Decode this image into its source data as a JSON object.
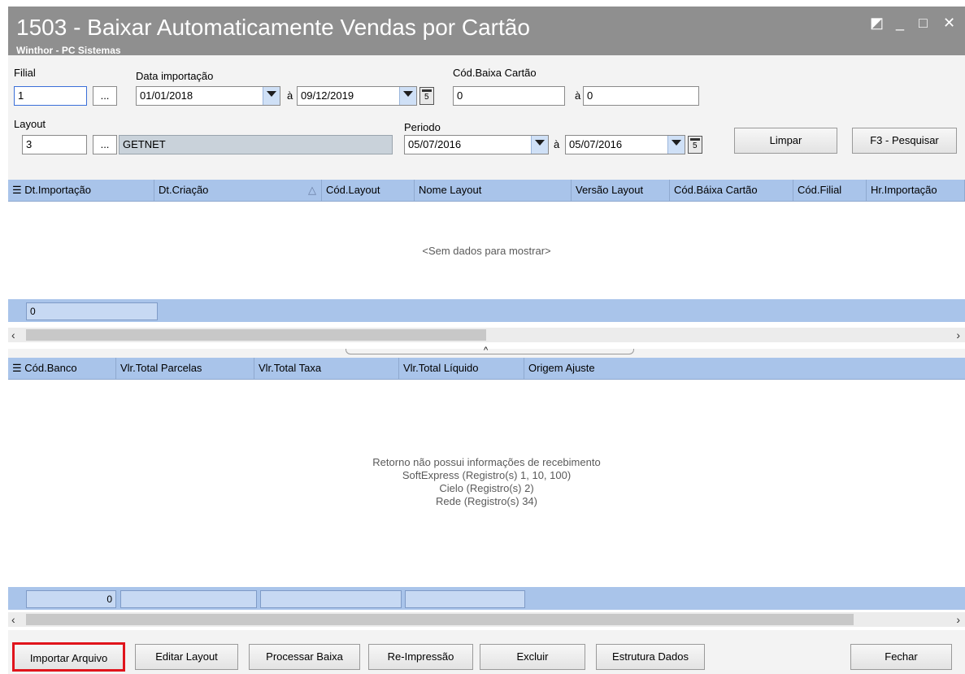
{
  "window": {
    "title": "1503 - Baixar Automaticamente Vendas por Cartão",
    "subtitle": "Winthor - PC Sistemas",
    "btn_restore": "◩",
    "btn_minimize": "_",
    "btn_maximize": "□",
    "btn_close": "✕"
  },
  "filters": {
    "filial_label": "Filial",
    "filial_value": "1",
    "ellipsis": "...",
    "data_importacao_label": "Data importação",
    "data_importacao_from": "01/01/2018",
    "a_label": "à",
    "data_importacao_to": "09/12/2019",
    "cod_baixa_label": "Cód.Baixa Cartão",
    "cod_baixa_from": "0",
    "cod_baixa_to": "0",
    "layout_label": "Layout",
    "layout_code": "3",
    "layout_name": "GETNET",
    "periodo_label": "Periodo",
    "periodo_from": "05/07/2016",
    "periodo_to": "05/07/2016",
    "limpar_label": "Limpar",
    "pesquisar_label": "F3 - Pesquisar"
  },
  "grid1": {
    "columns": [
      "Dt.Importação",
      "Dt.Criação",
      "Cód.Layout",
      "Nome Layout",
      "Versão Layout",
      "Cód.Báixa Cartão",
      "Cód.Filial",
      "Hr.Importação"
    ],
    "empty_text": "<Sem dados para mostrar>",
    "footer_count": "0"
  },
  "grid2": {
    "columns": [
      "Cód.Banco",
      "Vlr.Total Parcelas",
      "Vlr.Total Taxa",
      "Vlr.Total Líquido",
      "Origem Ajuste"
    ],
    "empty_text": "Retorno não possui informações de recebimento\nSoftExpress (Registro(s) 1, 10, 100)\nCielo (Registro(s) 2)\nRede (Registro(s) 34)",
    "footer_count": "0"
  },
  "buttons": {
    "importar": "Importar Arquivo",
    "editar_layout": "Editar Layout",
    "processar_baixa": "Processar Baixa",
    "reimpressao": "Re-Impressão",
    "excluir": "Excluir",
    "estrutura_dados": "Estrutura Dados",
    "fechar": "Fechar"
  },
  "colors": {
    "titlebar": "#8f8f8f",
    "grid_header": "#a9c4ea",
    "highlight": "#e0141c"
  }
}
